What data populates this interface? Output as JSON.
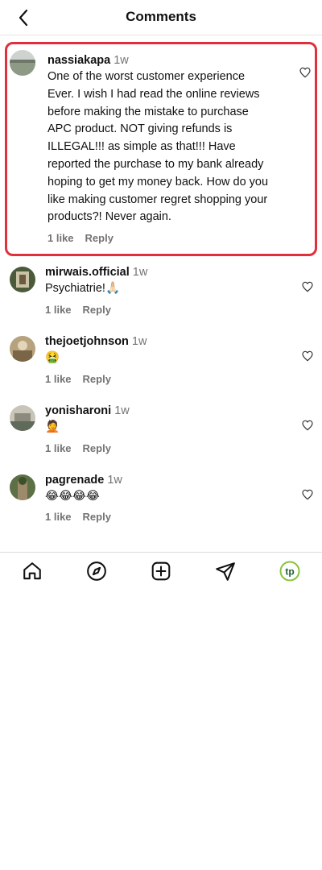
{
  "header": {
    "title": "Comments",
    "back_icon": "chevron-left-icon"
  },
  "comments": [
    {
      "username": "nassiakapa",
      "time": "1w",
      "text": "One of the worst customer experience Ever. I wish I had read the online reviews before making the mistake to purchase APC product. NOT giving refunds is ILLEGAL!!! as simple as that!!! Have reported the purchase to my bank already hoping to get my money back. How do you like making customer regret shopping your products?! Never again.",
      "likes": "1 like",
      "reply": "Reply"
    },
    {
      "username": "mirwais.official",
      "time": "1w",
      "text": "Psychiatrie!🙏🏻",
      "likes": "1 like",
      "reply": "Reply"
    },
    {
      "username": "thejoetjohnson",
      "time": "1w",
      "text": "🤮",
      "likes": "1 like",
      "reply": "Reply"
    },
    {
      "username": "yonisharoni",
      "time": "1w",
      "text": "🤦",
      "likes": "1 like",
      "reply": "Reply"
    },
    {
      "username": "pagrenade",
      "time": "1w",
      "text": "😂😂😂😂",
      "likes": "1 like",
      "reply": "Reply"
    }
  ],
  "nav": {
    "items": [
      "home-icon",
      "explore-compass-icon",
      "create-post-icon",
      "direct-message-icon",
      "profile-avatar-icon"
    ],
    "profile_initials": "tp",
    "profile_color": "#8ac33b"
  },
  "colors": {
    "highlight_border": "#e0303c",
    "secondary_text": "#737373"
  }
}
